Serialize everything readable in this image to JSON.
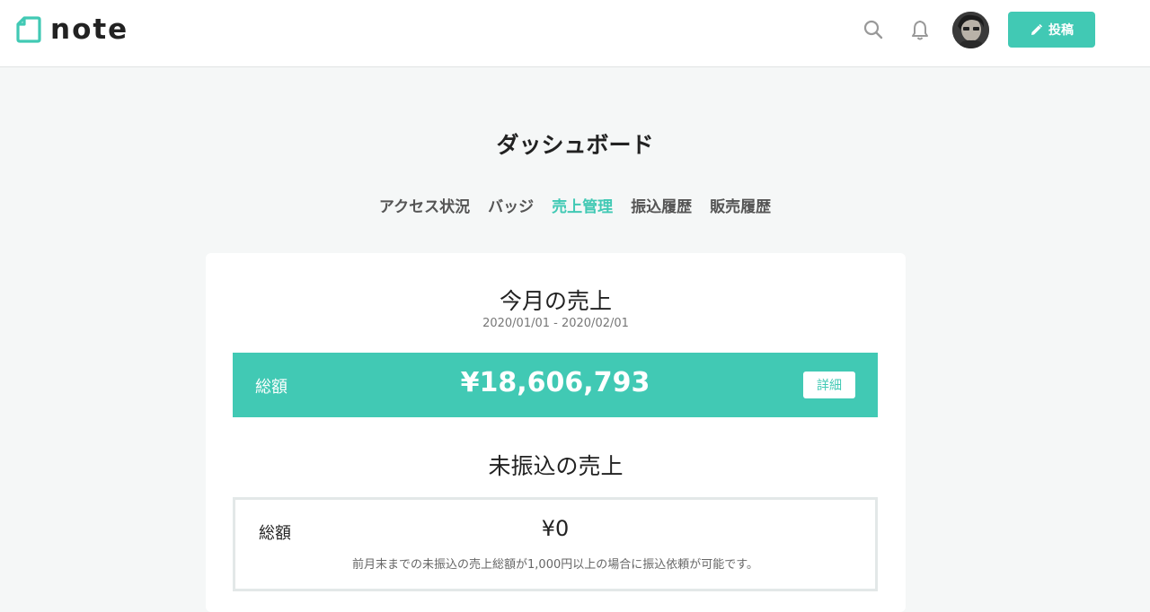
{
  "header": {
    "logo_text": "note",
    "post_label": "投稿",
    "icons": [
      "note-logo-icon",
      "search-icon",
      "bell-icon",
      "avatar",
      "pencil-icon"
    ]
  },
  "page": {
    "title": "ダッシュボード"
  },
  "tabs": [
    {
      "label": "アクセス状況",
      "active": false
    },
    {
      "label": "バッジ",
      "active": false
    },
    {
      "label": "売上管理",
      "active": true
    },
    {
      "label": "振込履歴",
      "active": false
    },
    {
      "label": "販売履歴",
      "active": false
    }
  ],
  "monthly_sales": {
    "title": "今月の売上",
    "period": "2020/01/01 - 2020/02/01",
    "total_label": "総額",
    "total_value": "¥18,606,793",
    "detail_label": "詳細"
  },
  "unpaid_sales": {
    "title": "未振込の売上",
    "total_label": "総額",
    "total_value": "¥0",
    "note": "前月末までの未振込の売上総額が1,000円以上の場合に振込依頼が可能です。"
  },
  "colors": {
    "accent": "#41c9b4",
    "background": "#f5f7f7",
    "card": "#ffffff"
  }
}
